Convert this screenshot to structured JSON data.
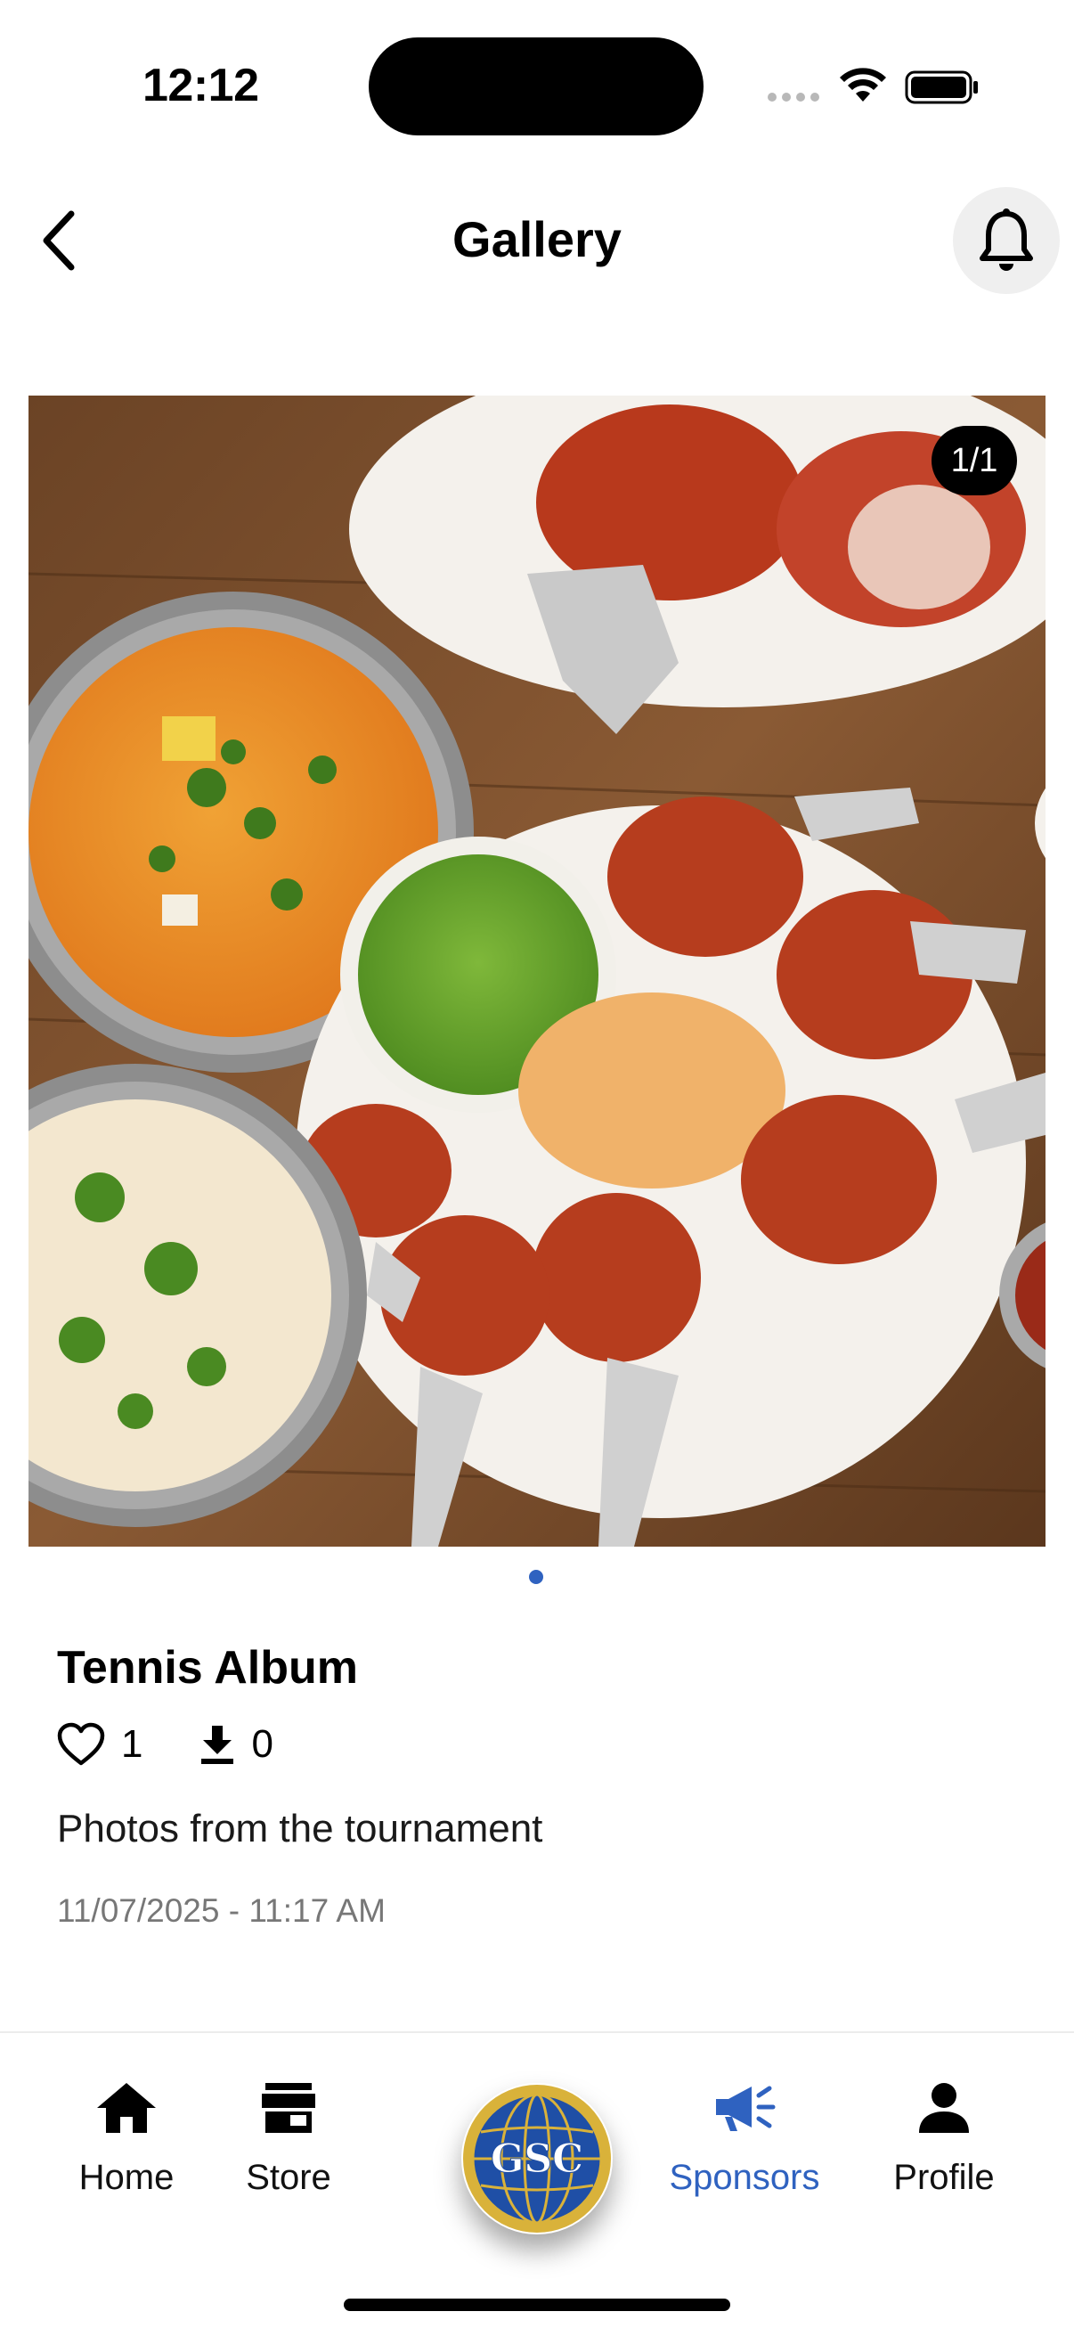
{
  "status_bar": {
    "time": "12:12"
  },
  "header": {
    "title": "Gallery"
  },
  "gallery": {
    "counter": "1/1"
  },
  "album": {
    "title": "Tennis Album",
    "likes": "1",
    "downloads": "0",
    "description": "Photos from the tournament",
    "date": "11/07/2025 - 11:17 AM"
  },
  "bottom_nav": {
    "items": [
      {
        "label": "Home",
        "icon": "home-icon"
      },
      {
        "label": "Store",
        "icon": "store-icon"
      },
      {
        "label": "Sponsors",
        "icon": "megaphone-icon"
      },
      {
        "label": "Profile",
        "icon": "person-icon"
      }
    ],
    "active": "Sponsors",
    "center_logo_text": "GSC"
  },
  "colors": {
    "accent": "#2f62c0",
    "logo_gold": "#d9b23a",
    "logo_blue": "#1f4fa6"
  }
}
